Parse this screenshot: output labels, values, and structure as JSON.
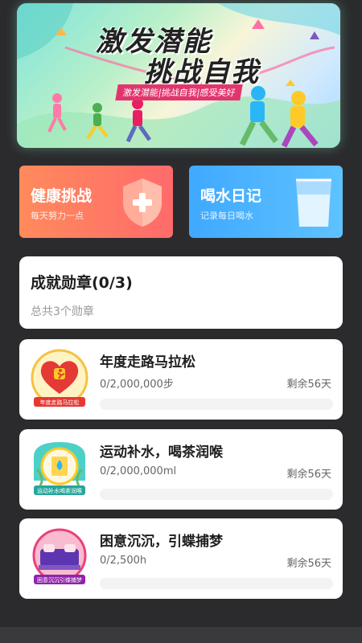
{
  "banner": {
    "title_line1": "激发潜能",
    "title_line2": "挑战自我",
    "subtitle": "激发潜能|挑战自我|感受美好"
  },
  "tiles": {
    "health": {
      "title": "健康挑战",
      "subtitle": "每天努力一点"
    },
    "water": {
      "title": "喝水日记",
      "subtitle": "记录每日喝水"
    }
  },
  "badges": {
    "title": "成就勋章(0/3)",
    "total": "总共3个勋章"
  },
  "achievements": [
    {
      "name": "年度走路马拉松",
      "progress": "0/2,000,000步",
      "remaining": "剩余56天",
      "percent": 0,
      "medal_label": "年度走路马拉松"
    },
    {
      "name": "运动补水，喝茶润喉",
      "progress": "0/2,000,000ml",
      "remaining": "剩余56天",
      "percent": 0,
      "medal_label": "运动补水喝茶润喉"
    },
    {
      "name": "困意沉沉，引蝶捕梦",
      "progress": "0/2,500h",
      "remaining": "剩余56天",
      "percent": 0,
      "medal_label": "困意沉沉引蝶捕梦"
    }
  ],
  "colors": {
    "health_tile": "#ff7a60",
    "water_tile": "#4ab3ff",
    "progress_fill": "#ff8a5c"
  }
}
